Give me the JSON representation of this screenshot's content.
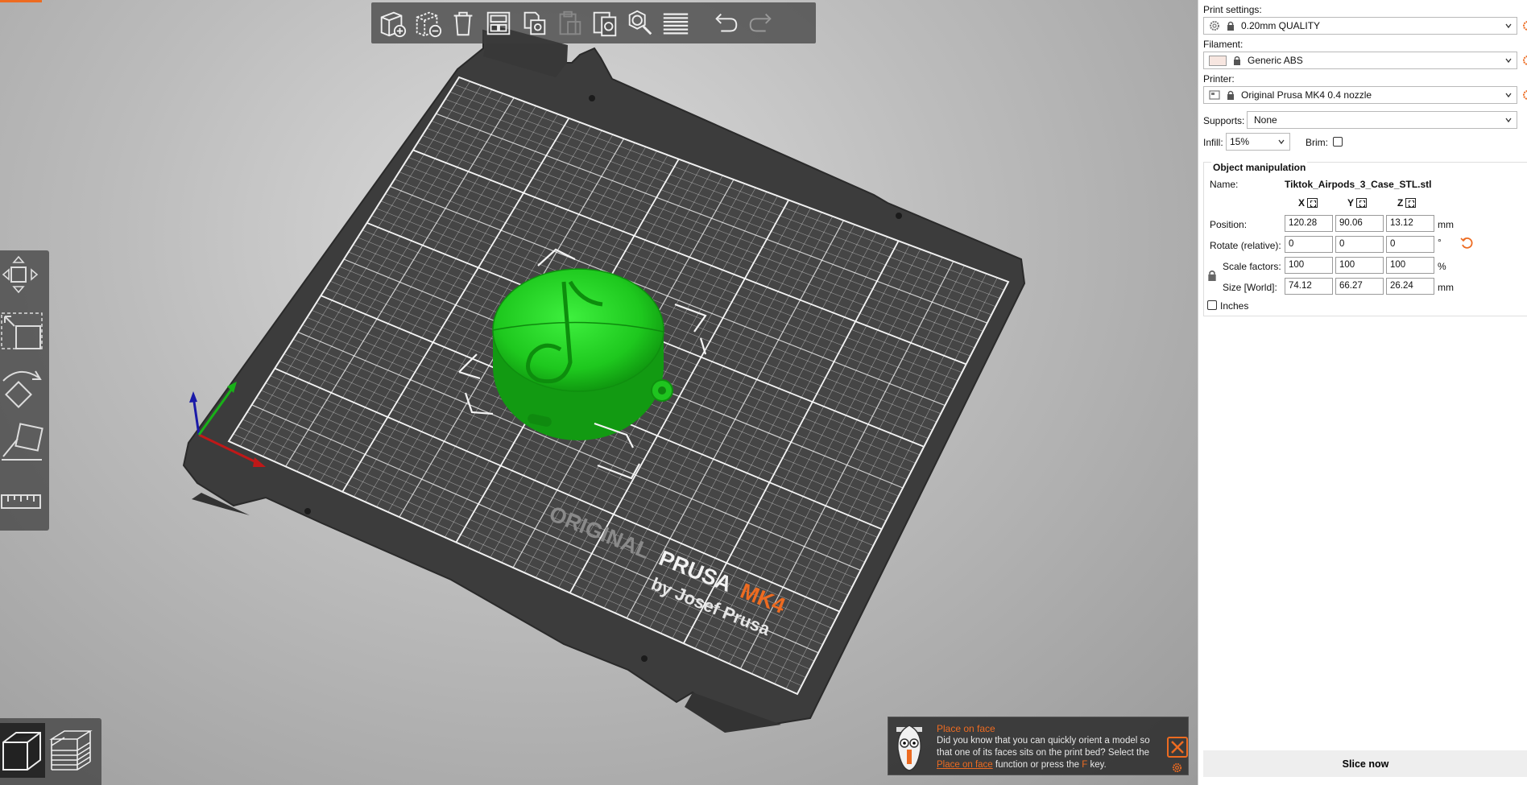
{
  "toolbar": {
    "buttons": [
      {
        "name": "add-object-icon"
      },
      {
        "name": "delete-object-icon"
      },
      {
        "name": "delete-all-icon"
      },
      {
        "name": "arrange-icon"
      },
      {
        "name": "copy-icon"
      },
      {
        "name": "paste-icon"
      },
      {
        "name": "instances-icon"
      },
      {
        "name": "search-icon"
      },
      {
        "name": "layers-editing-icon"
      },
      {
        "name": "undo-icon"
      },
      {
        "name": "redo-icon"
      }
    ]
  },
  "left_tools": [
    {
      "name": "move-tool-icon"
    },
    {
      "name": "scale-tool-icon"
    },
    {
      "name": "rotate-tool-icon"
    },
    {
      "name": "place-on-face-tool-icon"
    },
    {
      "name": "measure-tool-icon"
    }
  ],
  "bed": {
    "brand_line1_a": "ORIGINAL",
    "brand_line1_b": "PRUSA",
    "brand_line1_c": "MK4",
    "brand_line2": "by Josef Prusa",
    "model_color": "#22dd22",
    "accent_color": "#ed6b21"
  },
  "hint": {
    "title": "Place on face",
    "text_a": "Did you know that you can quickly orient a model so that one of its faces sits on the print bed? Select the ",
    "link": "Place on face",
    "text_b": " function or press the ",
    "key": "F",
    "text_c": " key."
  },
  "sidebar": {
    "print_settings_label": "Print settings:",
    "print_settings_value": "0.20mm QUALITY",
    "filament_label": "Filament:",
    "filament_value": "Generic ABS",
    "filament_color": "#f7e6e0",
    "printer_label": "Printer:",
    "printer_value": "Original Prusa MK4 0.4 nozzle",
    "supports_label": "Supports:",
    "supports_value": "None",
    "infill_label": "Infill:",
    "infill_value": "15%",
    "brim_label": "Brim:",
    "brim_checked": false
  },
  "object_manipulation": {
    "title": "Object manipulation",
    "name_label": "Name:",
    "name_value": "Tiktok_Airpods_3_Case_STL.stl",
    "axis_x": "X",
    "axis_y": "Y",
    "axis_z": "Z",
    "position_label": "Position:",
    "position": [
      "120.28",
      "90.06",
      "13.12"
    ],
    "position_unit": "mm",
    "rotate_label": "Rotate (relative):",
    "rotate": [
      "0",
      "0",
      "0"
    ],
    "rotate_unit": "°",
    "scale_label": "Scale factors:",
    "scale": [
      "100",
      "100",
      "100"
    ],
    "scale_unit": "%",
    "size_label": "Size [World]:",
    "size": [
      "74.12",
      "66.27",
      "26.24"
    ],
    "size_unit": "mm",
    "inches_label": "Inches",
    "inches_checked": false
  },
  "slice_button": "Slice now"
}
